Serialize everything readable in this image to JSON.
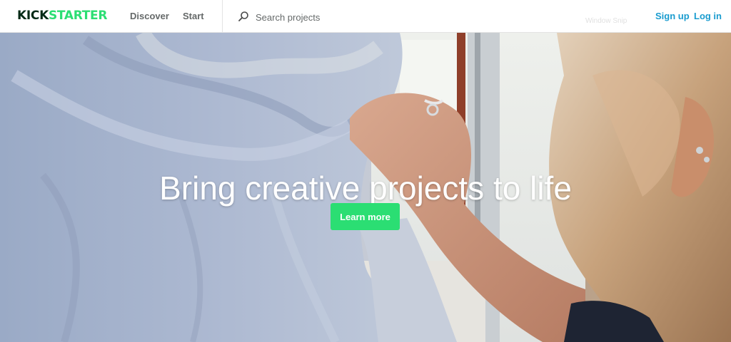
{
  "header": {
    "logo": {
      "part1": "KICK",
      "part2": "STARTER"
    },
    "nav": {
      "discover": "Discover",
      "start": "Start"
    },
    "search": {
      "icon": "search-icon",
      "placeholder": "Search projects",
      "value": ""
    },
    "overlay_text": "Window Snip",
    "auth": {
      "signup": "Sign up",
      "login": "Log in"
    }
  },
  "hero": {
    "title": "Bring creative projects to life",
    "cta_label": "Learn more"
  },
  "colors": {
    "brand_green": "#2bde73",
    "brand_dark": "#022a16",
    "link_blue": "#1a9ccf",
    "nav_gray": "#656969"
  }
}
